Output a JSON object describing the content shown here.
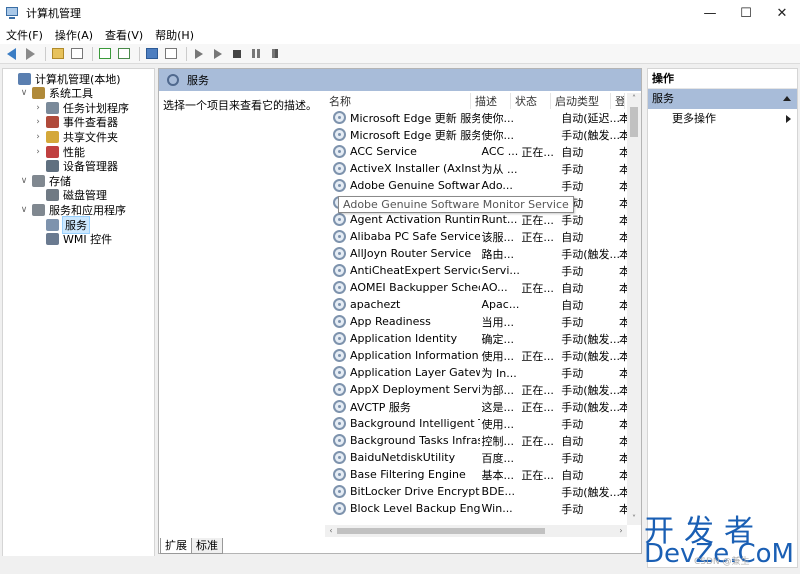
{
  "window": {
    "title": "计算机管理",
    "buttons": {
      "minimize": "—",
      "maximize": "☐",
      "close": "✕"
    }
  },
  "menu": [
    "文件(F)",
    "操作(A)",
    "查看(V)",
    "帮助(H)"
  ],
  "tree": [
    {
      "label": "计算机管理(本地)",
      "level": 0,
      "twisty": "",
      "color": "#5a7fb0"
    },
    {
      "label": "系统工具",
      "level": 1,
      "twisty": "∨",
      "color": "#b08a3a"
    },
    {
      "label": "任务计划程序",
      "level": 2,
      "twisty": "›",
      "color": "#7a8a9a"
    },
    {
      "label": "事件查看器",
      "level": 2,
      "twisty": "›",
      "color": "#b04a3a"
    },
    {
      "label": "共享文件夹",
      "level": 2,
      "twisty": "›",
      "color": "#d4a83a"
    },
    {
      "label": "性能",
      "level": 2,
      "twisty": "›",
      "color": "#c04040"
    },
    {
      "label": "设备管理器",
      "level": 2,
      "twisty": "",
      "color": "#607080"
    },
    {
      "label": "存储",
      "level": 1,
      "twisty": "∨",
      "color": "#808890"
    },
    {
      "label": "磁盘管理",
      "level": 2,
      "twisty": "",
      "color": "#707a84"
    },
    {
      "label": "服务和应用程序",
      "level": 1,
      "twisty": "∨",
      "color": "#808890"
    },
    {
      "label": "服务",
      "level": 2,
      "twisty": "",
      "color": "#7e93ad",
      "selected": true
    },
    {
      "label": "WMI 控件",
      "level": 2,
      "twisty": "",
      "color": "#6a7a90"
    }
  ],
  "middle": {
    "header": "服务",
    "description": "选择一个项目来查看它的描述。",
    "columns": {
      "name": "名称",
      "desc": "描述",
      "status": "状态",
      "startup": "启动类型",
      "logon": "登"
    }
  },
  "services": [
    {
      "name": "Microsoft Edge 更新 服务 (...",
      "desc": "使你...",
      "status": "",
      "startup": "自动(延迟...",
      "logon": "本"
    },
    {
      "name": "Microsoft Edge 更新 服务 (...",
      "desc": "使你...",
      "status": "",
      "startup": "手动(触发...",
      "logon": "本"
    },
    {
      "name": "ACC Service",
      "desc": "ACC ...",
      "status": "正在...",
      "startup": "自动",
      "logon": "本"
    },
    {
      "name": "ActiveX Installer (AxInstSV)",
      "desc": "为从 ...",
      "status": "",
      "startup": "手动",
      "logon": "本"
    },
    {
      "name": "Adobe Genuine Software I...",
      "desc": "Ado...",
      "status": "",
      "startup": "手动",
      "logon": "本"
    },
    {
      "name": "",
      "desc": "",
      "status": "",
      "startup": "自动",
      "logon": "本"
    },
    {
      "name": "Agent Activation Runtime_...",
      "desc": "Runt...",
      "status": "正在...",
      "startup": "手动",
      "logon": "本"
    },
    {
      "name": "Alibaba PC Safe Service",
      "desc": "该服...",
      "status": "正在...",
      "startup": "自动",
      "logon": "本"
    },
    {
      "name": "AllJoyn Router Service",
      "desc": "路由...",
      "status": "",
      "startup": "手动(触发...",
      "logon": "本"
    },
    {
      "name": "AntiCheatExpert Service",
      "desc": "Servi...",
      "status": "",
      "startup": "手动",
      "logon": "本"
    },
    {
      "name": "AOMEI Backupper Schedul...",
      "desc": "AO...",
      "status": "正在...",
      "startup": "自动",
      "logon": "本"
    },
    {
      "name": "apachezt",
      "desc": "Apac...",
      "status": "",
      "startup": "自动",
      "logon": "本"
    },
    {
      "name": "App Readiness",
      "desc": "当用...",
      "status": "",
      "startup": "手动",
      "logon": "本"
    },
    {
      "name": "Application Identity",
      "desc": "确定...",
      "status": "",
      "startup": "手动(触发...",
      "logon": "本"
    },
    {
      "name": "Application Information",
      "desc": "使用...",
      "status": "正在...",
      "startup": "手动(触发...",
      "logon": "本"
    },
    {
      "name": "Application Layer Gateway ...",
      "desc": "为 In...",
      "status": "",
      "startup": "手动",
      "logon": "本"
    },
    {
      "name": "AppX Deployment Service ...",
      "desc": "为部...",
      "status": "正在...",
      "startup": "手动(触发...",
      "logon": "本"
    },
    {
      "name": "AVCTP 服务",
      "desc": "这是...",
      "status": "正在...",
      "startup": "手动(触发...",
      "logon": "本"
    },
    {
      "name": "Background Intelligent Tra...",
      "desc": "使用...",
      "status": "",
      "startup": "手动",
      "logon": "本"
    },
    {
      "name": "Background Tasks Infrastru...",
      "desc": "控制...",
      "status": "正在...",
      "startup": "自动",
      "logon": "本"
    },
    {
      "name": "BaiduNetdiskUtility",
      "desc": "百度...",
      "status": "",
      "startup": "手动",
      "logon": "本"
    },
    {
      "name": "Base Filtering Engine",
      "desc": "基本...",
      "status": "正在...",
      "startup": "自动",
      "logon": "本"
    },
    {
      "name": "BitLocker Drive Encryption ...",
      "desc": "BDE...",
      "status": "",
      "startup": "手动(触发...",
      "logon": "本"
    },
    {
      "name": "Block Level Backup Engine ...",
      "desc": "Win...",
      "status": "",
      "startup": "手动",
      "logon": "本"
    }
  ],
  "tooltip": "Adobe Genuine Software Monitor Service",
  "tabs": [
    "扩展",
    "标准"
  ],
  "actions": {
    "header": "操作",
    "section": "服务",
    "more": "更多操作"
  },
  "watermark": {
    "top": "开发者",
    "bottom": "DevZe.CoM",
    "faint": "CSDN @兼生"
  },
  "colors": {
    "header_bar": "#a8bcd9",
    "selection": "#cce8ff",
    "watermark": "#1a5fb4"
  }
}
